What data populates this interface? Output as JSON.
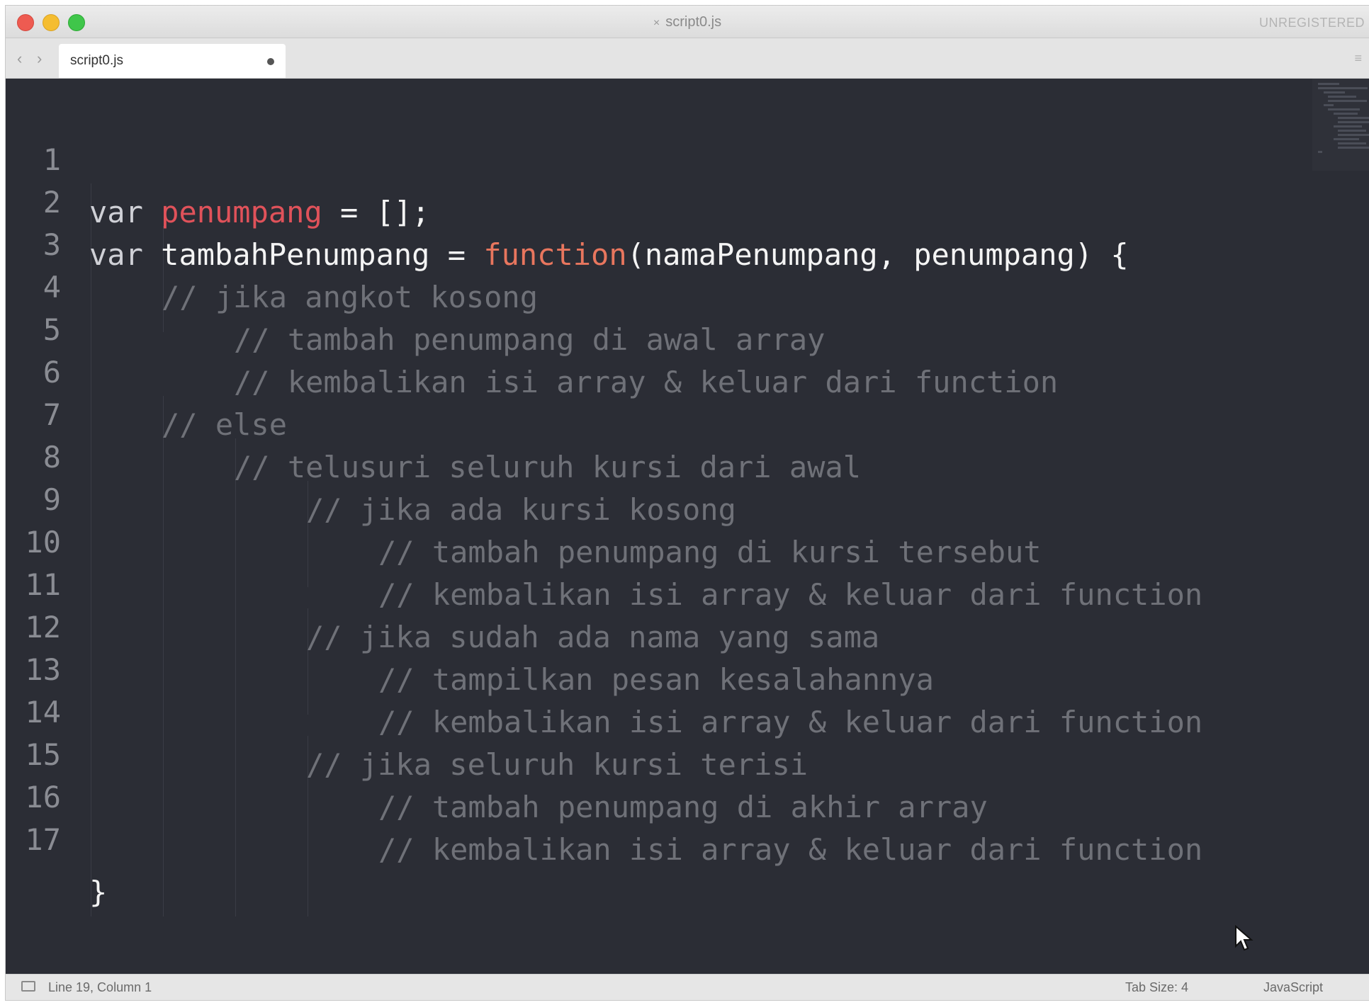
{
  "window": {
    "title": "script0.js",
    "title_close": "×",
    "unregistered": "UNREGISTERED"
  },
  "tabbar": {
    "back": "‹",
    "forward": "›",
    "tab_label": "script0.js",
    "menu": "≡"
  },
  "editor": {
    "lines": [
      {
        "n": "1"
      },
      {
        "n": "2"
      },
      {
        "n": "3"
      },
      {
        "n": "4"
      },
      {
        "n": "5"
      },
      {
        "n": "6"
      },
      {
        "n": "7"
      },
      {
        "n": "8"
      },
      {
        "n": "9"
      },
      {
        "n": "10"
      },
      {
        "n": "11"
      },
      {
        "n": "12"
      },
      {
        "n": "13"
      },
      {
        "n": "14"
      },
      {
        "n": "15"
      },
      {
        "n": "16"
      },
      {
        "n": "17"
      }
    ],
    "code": {
      "l1": {
        "kw": "var",
        "name": "penumpang",
        "rest": " = [];"
      },
      "l2": {
        "kw": "var",
        "name": "tambahPenumpang",
        "eq": " = ",
        "fn": "function",
        "rest": "(namaPenumpang, penumpang) {"
      },
      "l3": "// jika angkot kosong",
      "l4": "// tambah penumpang di awal array",
      "l5": "// kembalikan isi array & keluar dari function",
      "l6": "// else",
      "l7": "// telusuri seluruh kursi dari awal",
      "l8": "// jika ada kursi kosong",
      "l9": "// tambah penumpang di kursi tersebut",
      "l10": "// kembalikan isi array & keluar dari function",
      "l11": "// jika sudah ada nama yang sama",
      "l12": "// tampilkan pesan kesalahannya",
      "l13": "// kembalikan isi array & keluar dari function",
      "l14": "// jika seluruh kursi terisi",
      "l15": "// tambah penumpang di akhir array",
      "l16": "// kembalikan isi array & keluar dari function",
      "l17": "}"
    }
  },
  "statusbar": {
    "position": "Line 19, Column 1",
    "tab_size": "Tab Size: 4",
    "syntax": "JavaScript"
  },
  "colors": {
    "background": "#2b2d35",
    "keyword": "#cfd0d6",
    "variable": "#e0525a",
    "function_keyword": "#e8765e",
    "comment": "#6f7178"
  },
  "icons": [
    "close-traffic-icon",
    "minimize-traffic-icon",
    "zoom-traffic-icon",
    "back-arrow-icon",
    "forward-arrow-icon",
    "tab-dirty-dot-icon",
    "panel-menu-icon",
    "mouse-cursor-icon",
    "status-panel-icon"
  ]
}
